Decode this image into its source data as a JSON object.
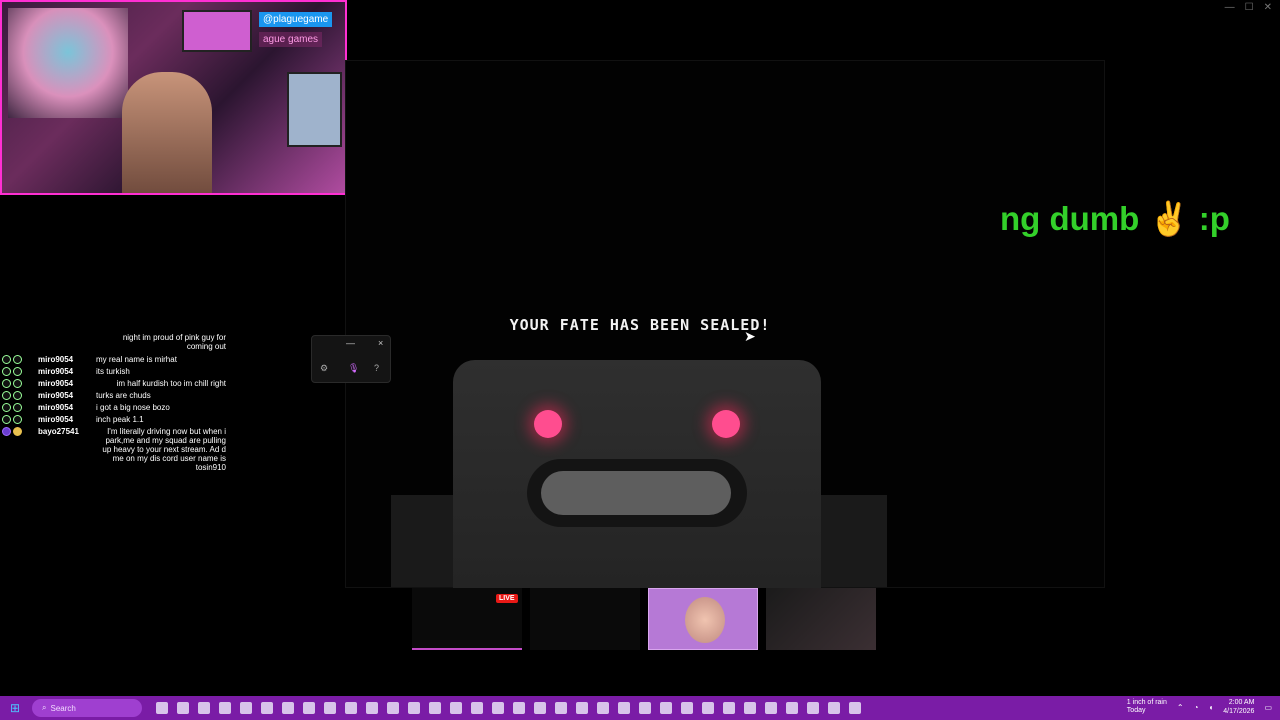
{
  "webcam": {
    "handle": "@plaguegame",
    "handle2": "ague games"
  },
  "window": {
    "minimize": "—",
    "maximize": "☐",
    "close": "✕"
  },
  "game": {
    "message": "YOUR FATE HAS BEEN SEALED!"
  },
  "alert": {
    "text": "ng dumb ✌ :p"
  },
  "chat": {
    "top_message": "night im proud of pink guy for coming out",
    "lines": [
      {
        "user": "miro9054",
        "msg": "my real name is mirhat",
        "align": "left"
      },
      {
        "user": "miro9054",
        "msg": "its turkish",
        "align": "left"
      },
      {
        "user": "miro9054",
        "msg": "im half kurdish too im chill right",
        "align": "right"
      },
      {
        "user": "miro9054",
        "msg": "turks are chuds",
        "align": "left"
      },
      {
        "user": "miro9054",
        "msg": "i got a big nose bozo",
        "align": "left"
      },
      {
        "user": "miro9054",
        "msg": "inch peak 1.1",
        "align": "left"
      },
      {
        "user": "bayo27541",
        "msg": "I'm literally driving now but when i park,me and my squad are pulling up heavy to your next stream. Ad d me on my dis cord user name is tosin910",
        "align": "right"
      }
    ]
  },
  "widget": {
    "minimize": "—",
    "close": "×",
    "gear_icon": "⚙",
    "mic_icon": "🎙",
    "help_icon": "?"
  },
  "thumbnails": {
    "live_label": "LIVE"
  },
  "taskbar": {
    "start_icon": "⊞",
    "search_label": "Search",
    "weather": "1 inch of rain",
    "weather_sub": "Today",
    "time": "2:00 AM",
    "date": "4/17/2026"
  },
  "colors": {
    "accent": "#ff2fd3",
    "taskbar": "#7a1ca6",
    "alert": "#33d02a",
    "eye": "#ff4d8f"
  }
}
